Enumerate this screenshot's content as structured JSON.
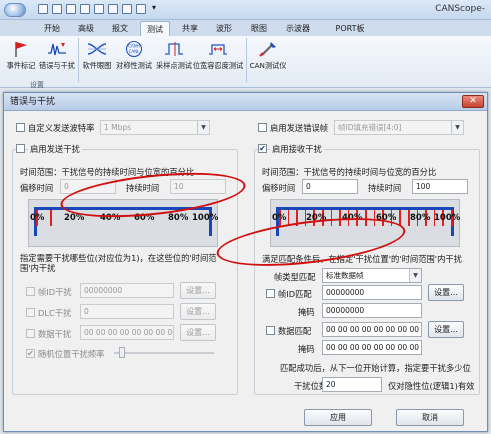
{
  "window": {
    "title": "CANScope-"
  },
  "ribbon_tabs": [
    {
      "label": "开始"
    },
    {
      "label": "高级"
    },
    {
      "label": "报文"
    },
    {
      "label": "测试"
    },
    {
      "label": "共享"
    },
    {
      "label": "波形"
    },
    {
      "label": "眼图"
    },
    {
      "label": "示波器"
    },
    {
      "label": "PORT板"
    }
  ],
  "active_tab_index": 3,
  "ribbon_buttons": [
    {
      "label": "事件标记",
      "icon": "event-marker-icon"
    },
    {
      "label": "错误与干扰",
      "icon": "error-interference-icon"
    },
    {
      "label": "软件眼图",
      "icon": "software-eye-diagram-icon"
    },
    {
      "label": "对称性测试",
      "icon": "symmetry-test-icon"
    },
    {
      "label": "采样点测试",
      "icon": "sample-point-icon"
    },
    {
      "label": "位宽容忍度测试",
      "icon": "bit-width-tolerance-icon"
    },
    {
      "label": "CAN测试仪",
      "icon": "can-tester-icon"
    }
  ],
  "ribbon_group_label": "设置",
  "dialog": {
    "title": "错误与干扰",
    "close_glyph": "✕",
    "custom_baud": {
      "label": "自定义发送波特率",
      "checked": false,
      "value": "1 Mbps"
    },
    "send_error": {
      "label": "启用发送错误帧",
      "checked": false,
      "value": "帧ID填充错误[4:0]"
    },
    "send_interference": {
      "label": "启用发送干扰",
      "checked": false,
      "range_note": "时间范围：干扰信号的持续时间与位宽的百分比",
      "offset_label": "偏移时间",
      "offset_value": "0",
      "duration_label": "持续时间",
      "duration_value": "10",
      "percent_ticks": [
        "0%",
        "20%",
        "40%",
        "60%",
        "80%",
        "100%"
      ],
      "bits_note": "指定需要干扰哪些位(对应位为1)，在这些位的'时间范围'内干扰",
      "frame_id": {
        "label": "帧ID干扰",
        "value": "00000000",
        "button": "设置..."
      },
      "dlc": {
        "label": "DLC干扰",
        "value": "0",
        "button": "设置..."
      },
      "data": {
        "label": "数据干扰",
        "value": "00 00 00 00 00 00 00 00",
        "button": "设置..."
      },
      "random": {
        "label": "随机位置干扰频率",
        "checked": true,
        "slider_level": 0.05
      }
    },
    "recv_interference": {
      "label": "启用接收干扰",
      "checked": true,
      "range_note": "时间范围：干扰信号的持续时间与位宽的百分比",
      "offset_label": "偏移时间",
      "offset_value": "0",
      "duration_label": "持续时间",
      "duration_value": "100",
      "percent_ticks": [
        "0%",
        "20%",
        "40%",
        "60%",
        "80%",
        "100%"
      ],
      "match_note": "满足匹配条件后，在指定'干扰位置'的'时间范围'内干扰",
      "frame_type": {
        "label": "帧类型匹配",
        "value": "标准数据帧"
      },
      "frame_id": {
        "label": "帧ID匹配",
        "value": "00000000",
        "button": "设置..."
      },
      "id_mask": {
        "label": "掩码",
        "value": "00000000"
      },
      "data": {
        "label": "数据匹配",
        "value": "00 00 00 00 00 00 00 00",
        "button": "设置..."
      },
      "data_mask": {
        "label": "掩码",
        "value": "00 00 00 00 00 00 00 00"
      },
      "after_note": "匹配成功后，从下一位开始计算，指定要干扰多少位",
      "bit_count": {
        "label": "干扰位数",
        "value": "20",
        "suffix": "仅对隐性位(逻辑1)有效"
      }
    },
    "apply_label": "应用",
    "cancel_label": "取消"
  },
  "colors": {
    "accent": "#1747b8",
    "annotation": "#d10f0f",
    "marker": "#e02020"
  }
}
